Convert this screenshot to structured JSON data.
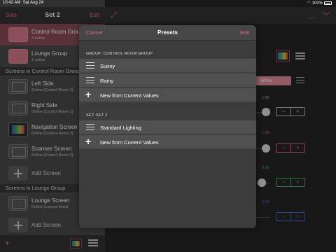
{
  "status_bar": {
    "time": "10:42 AM",
    "date": "Sat Aug 24",
    "battery": "100%"
  },
  "sidebar": {
    "back_label": "Sets",
    "title": "Set 2",
    "edit_label": "Edit",
    "groups": [
      {
        "name": "Control Room Group",
        "sub": "4 online"
      },
      {
        "name": "Lounge Group",
        "sub": "1 online"
      }
    ],
    "section_control": "Screens in Control Room Group",
    "control_screens": [
      {
        "name": "Left Side",
        "sub": "Online (Control Room 1)"
      },
      {
        "name": "Right Side",
        "sub": "Online (Control Room 1)"
      },
      {
        "name": "Navigation Screen",
        "sub": "Online (Control Room 2)"
      },
      {
        "name": "Scanner Screen",
        "sub": "Online (Control Room 2)"
      }
    ],
    "add_screen_label": "Add Screen",
    "section_lounge": "Screens in Lounge Group",
    "lounge_screens": [
      {
        "name": "Lounge Screen",
        "sub": "Online (Lounge Area)"
      }
    ]
  },
  "detail": {
    "white_label": "White",
    "channels": [
      {
        "value": "1.00",
        "color": "#bbbbbb"
      },
      {
        "value": "1.00",
        "color": "#e46c7f"
      },
      {
        "value": "0.96",
        "color": "#46b26b"
      },
      {
        "value": "0.84",
        "color": "#3c6fd9"
      }
    ]
  },
  "modal": {
    "cancel_label": "Cancel",
    "title": "Presets",
    "edit_label": "Edit",
    "group_section": "GROUP: CONTROL ROOM GROUP",
    "group_presets": [
      "Sunny",
      "Rainy"
    ],
    "new_from_current": "New from Current Values",
    "set_section": "SET: SET 2",
    "set_presets": [
      "Standard Lighting"
    ]
  }
}
